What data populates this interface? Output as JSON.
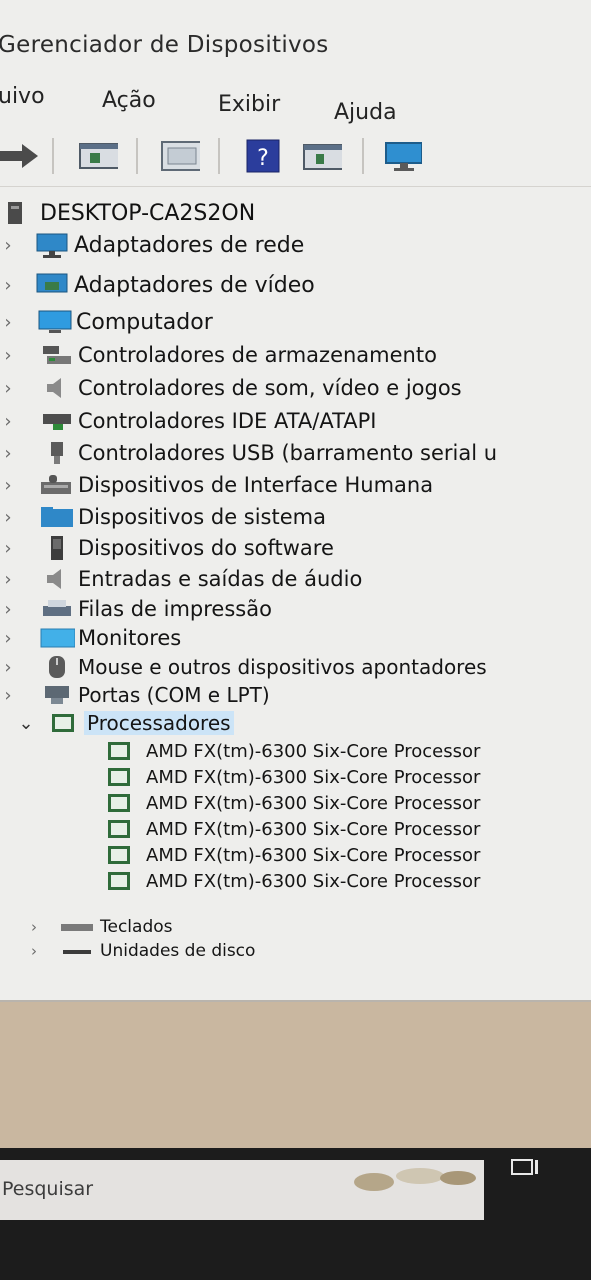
{
  "window": {
    "title": "Gerenciador de Dispositivos"
  },
  "menu": {
    "items": [
      "uivo",
      "Ação",
      "Exibir",
      "Ajuda"
    ]
  },
  "toolbar": {
    "icons": [
      "forward-icon",
      "properties-icon",
      "update-driver-icon",
      "help-icon",
      "device-view-icon",
      "monitor-scan-icon"
    ]
  },
  "tree": {
    "root": "DESKTOP-CA2S2ON",
    "categories": [
      "Adaptadores de rede",
      "Adaptadores de vídeo",
      "Computador",
      "Controladores de armazenamento",
      "Controladores de som, vídeo e jogos",
      "Controladores IDE ATA/ATAPI",
      "Controladores USB (barramento serial u",
      "Dispositivos de Interface Humana",
      "Dispositivos de sistema",
      "Dispositivos do software",
      "Entradas e saídas de áudio",
      "Filas de impressão",
      "Monitores",
      "Mouse e outros dispositivos apontadores",
      "Portas (COM e LPT)",
      "Processadores"
    ],
    "processors": [
      "AMD FX(tm)-6300 Six-Core Processor",
      "AMD FX(tm)-6300 Six-Core Processor",
      "AMD FX(tm)-6300 Six-Core Processor",
      "AMD FX(tm)-6300 Six-Core Processor",
      "AMD FX(tm)-6300 Six-Core Processor",
      "AMD FX(tm)-6300 Six-Core Processor"
    ],
    "after": [
      "Teclados",
      "Unidades de disco"
    ]
  },
  "taskbar": {
    "search_placeholder": "Pesquisar"
  },
  "colors": {
    "window_bg": "#eeeeec",
    "processor_icon": "#2f6b3a",
    "selection": "#cce4f7",
    "taskbar": "#1c1c1c"
  }
}
